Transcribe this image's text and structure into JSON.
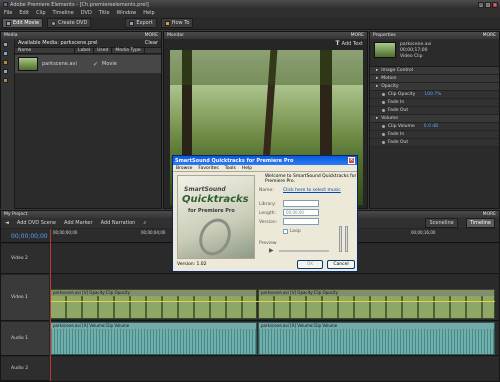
{
  "app": {
    "title": "Adobe Premiere Elements - [Ch.premiereelements.prel]"
  },
  "menu": [
    "File",
    "Edit",
    "Clip",
    "Timeline",
    "DVD",
    "Title",
    "Window",
    "Help"
  ],
  "toolbar": {
    "edit_movie": "Edit Movie",
    "create_dvd": "Create DVD",
    "export": "Export",
    "how_to": "How To"
  },
  "media": {
    "panel_title": "Media",
    "more": "MORE",
    "available": "Available Media: parkscene.prel",
    "clear": "Clear",
    "cols": [
      "Name",
      "Label",
      "Used",
      "Media Type"
    ],
    "item": {
      "name": "parkscene.avi",
      "type": "Movie"
    }
  },
  "monitor": {
    "panel_title": "Monitor",
    "more": "MORE",
    "add_text": "Add Text"
  },
  "properties": {
    "panel_title": "Properties",
    "more": "MORE",
    "clip_name": "parkscene.avi",
    "meta1": "00;00;17;00",
    "meta2": "Video Clip",
    "rows": [
      {
        "label": "Image Control",
        "kind": "grp"
      },
      {
        "label": "Motion",
        "kind": "grp"
      },
      {
        "label": "Opacity",
        "kind": "grp"
      },
      {
        "label": "Clip Opacity",
        "value": "100.7%",
        "kind": "sub"
      },
      {
        "label": "Fade In",
        "kind": "sub"
      },
      {
        "label": "Fade Out",
        "kind": "sub"
      },
      {
        "label": "Volume",
        "kind": "grp"
      },
      {
        "label": "Clip Volume",
        "value": "0.0 dB",
        "kind": "sub"
      },
      {
        "label": "Fade In",
        "kind": "sub"
      },
      {
        "label": "Fade Out",
        "kind": "sub"
      }
    ]
  },
  "project": {
    "panel_title": "My Project",
    "more": "MORE",
    "timecode": "00;00;00;00",
    "add_dvd": "Add DVD Scene",
    "add_marker": "Add Marker",
    "add_narration": "Add Narration",
    "sceneline": "Sceneline",
    "timeline": "Timeline"
  },
  "ruler": [
    "00;00;00;00",
    "00;00;04;00",
    "00;00;08;00",
    "00;00;12;00",
    "00;00;16;00"
  ],
  "tracks": {
    "video2": "Video 2",
    "video1": "Video 1",
    "audio1": "Audio 1",
    "audio2": "Audio 2",
    "v1_clip_a": "parkscene.avi [V] Opacity:Clip Opacity",
    "v1_clip_b": "parkscene.avi [V] Opacity:Clip Opacity",
    "a1_clip_a": "parkscene.avi [A] Volume:Clip Volume",
    "a1_clip_b": "parkscene.avi [A] Volume:Clip Volume"
  },
  "dialog": {
    "title": "SmartSound Quicktracks for Premiere Pro",
    "menu": [
      "Browse",
      "Favorites",
      "Tools",
      "Help"
    ],
    "welcome": "Welcome to SmartSound Quicktracks for Premiere Pro.",
    "name_label": "Name:",
    "name_link": "Click here to select music",
    "library_label": "Library:",
    "length_label": "Length:",
    "length_value": "00;00;00",
    "version_label": "Version:",
    "loop": "Loop",
    "preview_label": "Preview",
    "logo_brand": "SmartSound",
    "logo_product": "Quicktracks",
    "logo_sub": "for Premiere Pro",
    "footer_version": "Version: 1.02",
    "ok": "OK",
    "cancel": "Cancel"
  },
  "colors": {
    "accent": "#4a6fa5",
    "video_clip": "#6d7b55",
    "audio_clip": "#5f9c9a",
    "playhead": "#c0392b"
  }
}
